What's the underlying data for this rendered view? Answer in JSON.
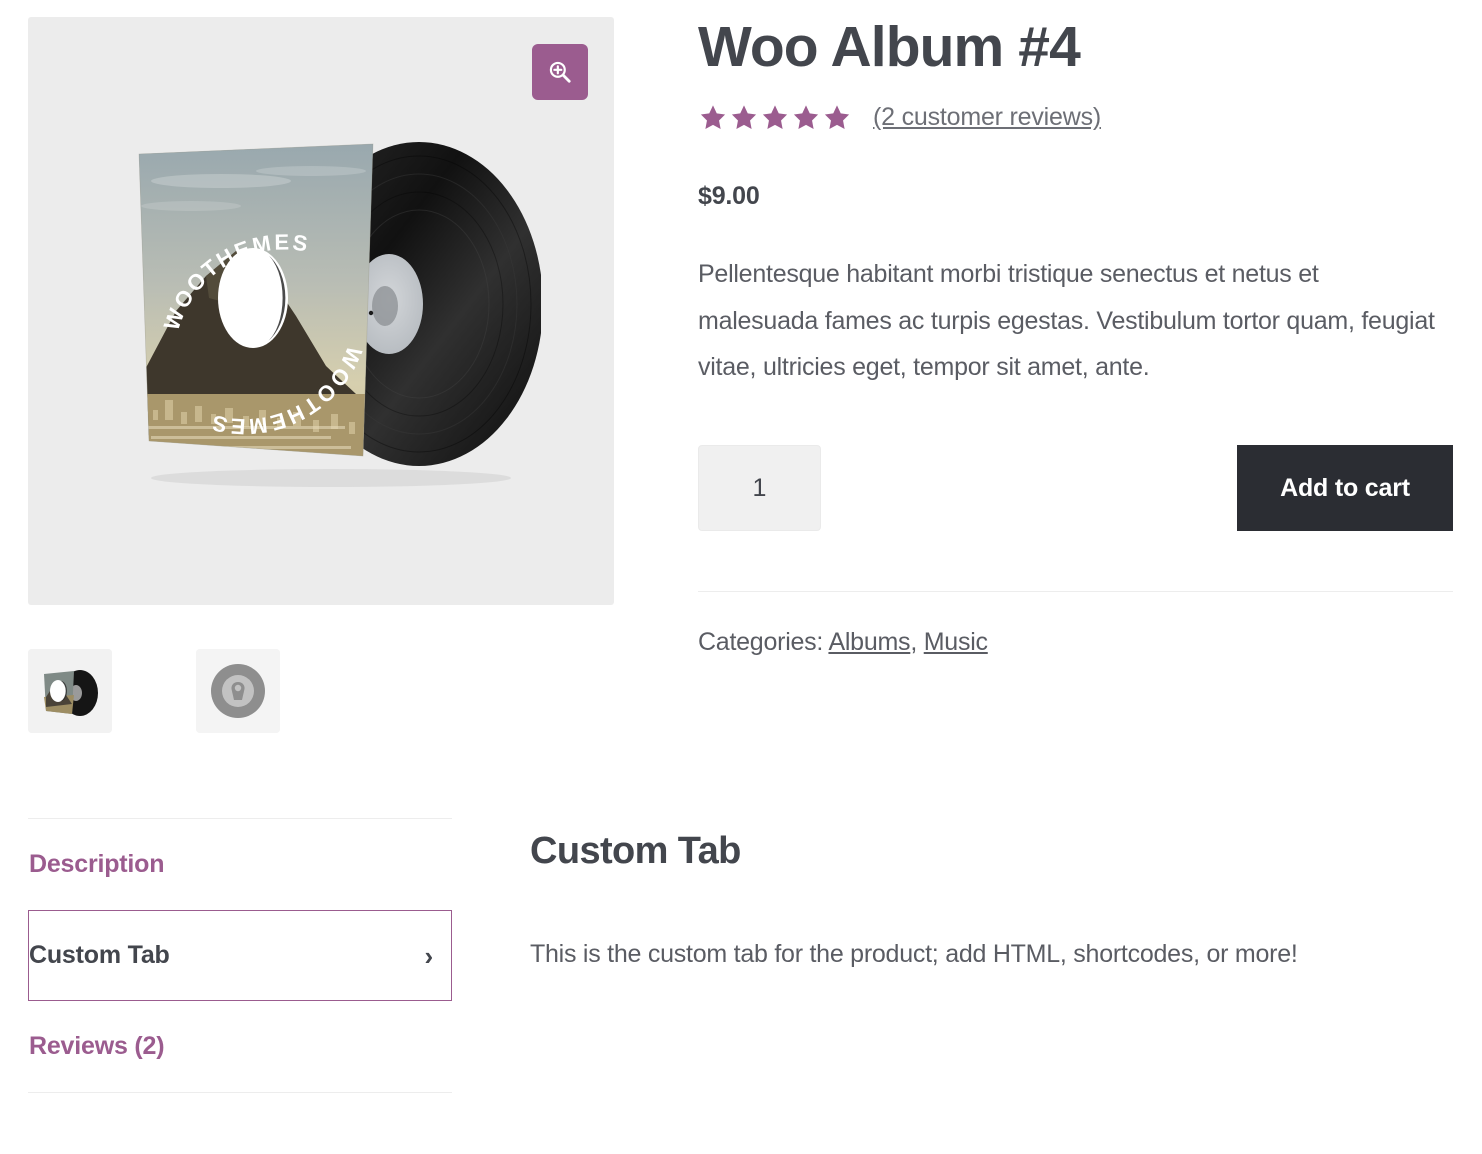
{
  "product": {
    "title": "Woo Album #4",
    "rating": {
      "stars_filled": 5,
      "stars_total": 5,
      "reviews_link": "(2 customer reviews)",
      "star_color": "#9b5c8f"
    },
    "price": "$9.00",
    "short_description": "Pellentesque habitant morbi tristique senectus et netus et malesuada fames ac turpis egestas. Vestibulum tortor quam, feugiat vitae, ultricies eget, tempor sit amet, ante.",
    "cart": {
      "quantity_value": "1",
      "quantity_placeholder": "1",
      "add_to_cart_label": "Add to cart",
      "button_color": "#2b2d33"
    },
    "meta": {
      "categories_label": "Categories:",
      "categories": [
        {
          "label": "Albums"
        },
        {
          "label": "Music"
        }
      ],
      "separator": ", "
    }
  },
  "gallery": {
    "zoom_icon": "magnifier-plus-icon",
    "zoom_button_color": "#9b5c8f",
    "main_image": {
      "alt": "Vinyl record album cover with mountain photo",
      "cover_text": "WOOTHEMES",
      "background": "#ececec"
    },
    "thumbnails": [
      {
        "name": "album-vinyl-thumbnail",
        "alt": "Album cover with vinyl record"
      },
      {
        "name": "placeholder-disc-thumbnail",
        "alt": "Grey placeholder disc image"
      }
    ]
  },
  "tabs": {
    "items": [
      {
        "label": "Description",
        "active": false
      },
      {
        "label": "Custom Tab",
        "active": true
      },
      {
        "label": "Reviews (2)",
        "active": false
      }
    ],
    "active_color": "#9b5c8f",
    "panel": {
      "title": "Custom Tab",
      "body": "This is the custom tab for the product; add HTML, shortcodes, or more!"
    }
  }
}
